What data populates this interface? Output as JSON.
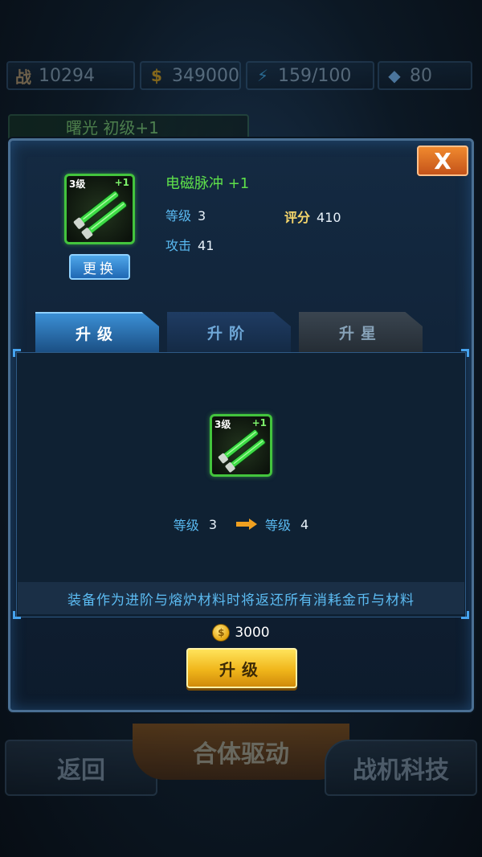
{
  "background": {
    "stats": [
      {
        "icon": "combat-power-icon",
        "glyph": "战",
        "value": "10294"
      },
      {
        "icon": "gold-coin-icon",
        "glyph": "$",
        "value": "349000"
      },
      {
        "icon": "energy-icon",
        "glyph": "⚡",
        "value": "159/100"
      },
      {
        "icon": "diamond-icon",
        "glyph": "◆",
        "value": "80"
      }
    ],
    "subtitle": "曙光 初级+1",
    "nav": {
      "back": "返回",
      "center": "合体驱动",
      "tech": "战机科技"
    }
  },
  "modal": {
    "close_label": "X",
    "item": {
      "level_badge": "3级",
      "plus_badge": "+1",
      "name": "电磁脉冲 +1",
      "level_label": "等级",
      "level_value": "3",
      "score_label": "评分",
      "score_value": "410",
      "attack_label": "攻击",
      "attack_value": "41"
    },
    "swap_label": "更换",
    "tabs": [
      {
        "label": "升级",
        "active": true
      },
      {
        "label": "升阶",
        "active": false
      },
      {
        "label": "升星",
        "active": false
      }
    ],
    "upgrade": {
      "from_label": "等级",
      "from_value": "3",
      "to_label": "等级",
      "to_value": "4",
      "notice": "装备作为进阶与熔炉材料时将返还所有消耗金币与材料",
      "cost": "3000",
      "button_label": "升级"
    }
  },
  "colors": {
    "accent_green": "#43c43d",
    "accent_blue": "#59b9f0",
    "accent_gold": "#f0b61b",
    "close_orange": "#f0892e"
  }
}
